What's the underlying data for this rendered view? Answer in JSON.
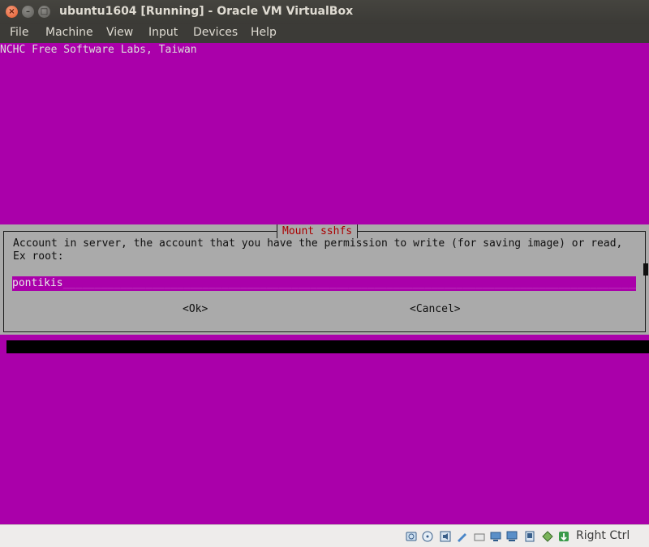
{
  "window": {
    "title": "ubuntu1604 [Running] - Oracle VM VirtualBox",
    "buttons": {
      "close": "×",
      "minimize": "–",
      "maximize": "□"
    }
  },
  "menubar": {
    "items": [
      "File",
      "Machine",
      "View",
      "Input",
      "Devices",
      "Help"
    ]
  },
  "vm_screen": {
    "backtitle": "NCHC Free Software Labs, Taiwan",
    "background_color": "#aa00aa",
    "dialog": {
      "title": "Mount sshfs",
      "prompt_line1": "Account in server, the account that you have the permission to write (for saving image) or read,",
      "prompt_line2": "Ex root:",
      "input_value": "pontikis",
      "ok_label": "<Ok>",
      "cancel_label": "<Cancel>"
    }
  },
  "statusbar": {
    "icons": [
      "hard-disk-icon",
      "optical-drive-icon",
      "audio-icon",
      "network-icon",
      "usb-icon",
      "shared-folders-icon",
      "display-icon",
      "video-capture-icon",
      "cpu-icon",
      "mouse-integration-icon",
      "arrow-down-icon"
    ],
    "host_key": "Right Ctrl"
  }
}
